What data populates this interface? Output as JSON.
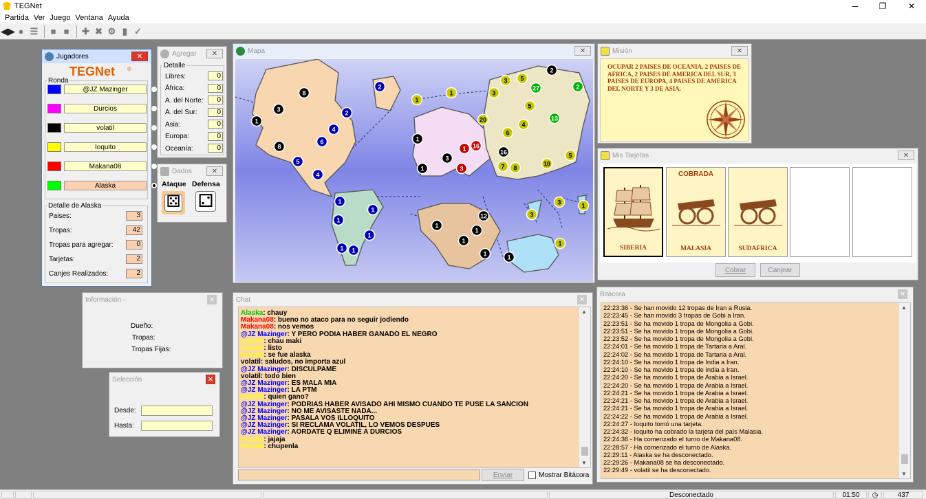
{
  "app": {
    "title": "TEGNet"
  },
  "menu": [
    "Partida",
    "Ver",
    "Juego",
    "Ventana",
    "Ayuda"
  ],
  "jugadores": {
    "title": "Jugadores",
    "logo": "TEGNet",
    "ronda_label": "Ronda",
    "players": [
      {
        "name": "@JZ Mazinger",
        "color": "#0000ff",
        "active": false
      },
      {
        "name": "Durcios",
        "color": "#ff00ff",
        "active": false
      },
      {
        "name": "volatil",
        "color": "#000000",
        "active": false
      },
      {
        "name": "Ioquito",
        "color": "#ffff00",
        "active": false
      },
      {
        "name": "Makana08",
        "color": "#ff0000",
        "active": false
      },
      {
        "name": "Alaska",
        "color": "#00ff00",
        "active": true
      }
    ],
    "detalle_title": "Detalle de Alaska",
    "detalle": [
      {
        "label": "Paises:",
        "value": "3"
      },
      {
        "label": "Tropas:",
        "value": "42"
      },
      {
        "label": "Tropas para agregar:",
        "value": "0"
      },
      {
        "label": "Tarjetas:",
        "value": "2"
      },
      {
        "label": "Canjes Realizados:",
        "value": "2"
      }
    ]
  },
  "agregar": {
    "title": "Agregar",
    "detalle_label": "Detalle",
    "rows": [
      {
        "label": "Libres:",
        "value": "0"
      },
      {
        "label": "África:",
        "value": "0"
      },
      {
        "label": "A. del Norte:",
        "value": "0"
      },
      {
        "label": "A. del Sur:",
        "value": "0"
      },
      {
        "label": "Asia:",
        "value": "0"
      },
      {
        "label": "Europa:",
        "value": "0"
      },
      {
        "label": "Oceanía:",
        "value": "0"
      }
    ]
  },
  "dados": {
    "title": "Dados",
    "ataque": "Ataque",
    "defensa": "Defensa"
  },
  "mapa": {
    "title": "Mapa"
  },
  "mision": {
    "title": "Misión",
    "text": "OCUPAR 2 PAISES DE OCEANIA, 2 PAISES DE AFRICA, 2 PAISES DE AMERICA DEL SUR, 3 PAISES DE EUROPA, 4 PAISES DE AMERICA DEL NORTE Y 3 DE ASIA."
  },
  "tarjetas": {
    "title": "Mis Tarjetas",
    "cards": [
      {
        "name": "SIBERIA",
        "kind": "ship-icon",
        "badge": ""
      },
      {
        "name": "MALASIA",
        "kind": "cannon-icon",
        "badge": "COBRADA"
      },
      {
        "name": "SUDAFRICA",
        "kind": "cannon-icon",
        "badge": ""
      }
    ],
    "cobrar": "Cobrar",
    "canjear": "Canjear"
  },
  "informacion": {
    "title": "Información -",
    "dueno": "Dueño:",
    "tropas": "Tropas:",
    "fijas": "Tropas Fijas:"
  },
  "seleccion": {
    "title": "Selección",
    "desde": "Desde:",
    "hasta": "Hasta:"
  },
  "chat": {
    "title": "Chat",
    "enviar": "Enviar",
    "mostrar": "Mostrar Bitácora",
    "messages": [
      {
        "user": "Alaska",
        "color": "#00c800",
        "text": "chauy"
      },
      {
        "user": "Makana08",
        "color": "#ff0000",
        "text": "bueno no ataco para no seguir jodiendo"
      },
      {
        "user": "Makana08",
        "color": "#ff0000",
        "text": "nos vemos"
      },
      {
        "user": "@JZ Mazinger",
        "color": "#0000ff",
        "text": "Y PERO PODIA HABER GANADO EL NEGRO"
      },
      {
        "user": "Ioquito",
        "color": "#ffff00",
        "text": "chau maki"
      },
      {
        "user": "Ioquito",
        "color": "#ffff00",
        "text": "listo"
      },
      {
        "user": "Ioquito",
        "color": "#ffff00",
        "text": "se fue alaska"
      },
      {
        "user": "volatil",
        "color": "#000000",
        "text": "saludos, no importa azul"
      },
      {
        "user": "@JZ Mazinger",
        "color": "#0000ff",
        "text": "DISCULPAME"
      },
      {
        "user": "volatil",
        "color": "#000000",
        "text": "todo bien"
      },
      {
        "user": "@JZ Mazinger",
        "color": "#0000ff",
        "text": "ES MALA MIA"
      },
      {
        "user": "@JZ Mazinger",
        "color": "#0000ff",
        "text": "LA PTM"
      },
      {
        "user": "Ioquito",
        "color": "#ffff00",
        "text": "quien gano?"
      },
      {
        "user": "@JZ Mazinger",
        "color": "#0000ff",
        "text": "PODRIAS HABER AVISADO AHI MISMO CUANDO TE PUSE LA SANCION"
      },
      {
        "user": "@JZ Mazinger",
        "color": "#0000ff",
        "text": "NO ME AVISASTE NADA..."
      },
      {
        "user": "@JZ Mazinger",
        "color": "#0000ff",
        "text": "PASALA VOS ILLOQUITO"
      },
      {
        "user": "@JZ Mazinger",
        "color": "#0000ff",
        "text": "SI RECLAMA VOLATIL, LO VEMOS DESPUES"
      },
      {
        "user": "@JZ Mazinger",
        "color": "#0000ff",
        "text": "AORDATE Q ELIMINÉ A DURCIOS"
      },
      {
        "user": "Ioquito",
        "color": "#ffff00",
        "text": "jajaja"
      },
      {
        "user": "Ioquito",
        "color": "#ffff00",
        "text": "chupenla"
      }
    ]
  },
  "bitacora": {
    "title": "Bitácora",
    "lines": [
      "22:23:36 - Se han movido 12 tropas de Iran a Rusia.",
      "22:23:45 - Se han movido 3 tropas de Gobi a Iran.",
      "22:23:51 - Se ha movido 1 tropa de Mongolia a Gobi.",
      "22:23:51 - Se ha movido 1 tropa de Mongolia a Gobi.",
      "22:23:52 - Se ha movido 1 tropa de Mongolia a Gobi.",
      "22:24:01 - Se ha movido 1 tropa de Tartaria a Aral.",
      "22:24:02 - Se ha movido 1 tropa de Tartaria a Aral.",
      "22:24:10 - Se ha movido 1 tropa de India a Iran.",
      "22:24:10 - Se ha movido 1 tropa de India a Iran.",
      "22:24:20 - Se ha movido 1 tropa de Arabia a Israel.",
      "22:24:20 - Se ha movido 1 tropa de Arabia a Israel.",
      "22:24:21 - Se ha movido 1 tropa de Arabia a Israel.",
      "22:24:21 - Se ha movido 1 tropa de Arabia a Israel.",
      "22:24:21 - Se ha movido 1 tropa de Arabia a Israel.",
      "22:24:22 - Se ha movido 1 tropa de Arabia a Israel.",
      "22:24:27 - Ioquito tomó una tarjeta.",
      "22:24:32 - Ioquito ha cobrado la tarjeta del país Malasia.",
      "22:24:36 - Ha comenzado el turno de Makana08.",
      "22:28:57 - Ha comenzado el turno de Alaska.",
      "22:29:11 - Alaska se ha desconectado.",
      "22:29:26 - Makana08 se ha desconectado.",
      "22:29:49 - volatil se ha desconectado."
    ]
  },
  "status": {
    "connection": "Desconectado",
    "time": "01:50",
    "count": "437"
  },
  "map_markers": [
    {
      "v": "8",
      "c": "#000000"
    },
    {
      "v": "3",
      "c": "#000000"
    },
    {
      "v": "1",
      "c": "#000000"
    },
    {
      "v": "8",
      "c": "#000000"
    },
    {
      "v": "2",
      "c": "#0000b4"
    },
    {
      "v": "2",
      "c": "#0000b4"
    },
    {
      "v": "4",
      "c": "#0000b4"
    },
    {
      "v": "6",
      "c": "#0000b4"
    },
    {
      "v": "5",
      "c": "#0000b4"
    },
    {
      "v": "4",
      "c": "#0000b4"
    },
    {
      "v": "1",
      "c": "#0000b4"
    },
    {
      "v": "1",
      "c": "#0000b4"
    },
    {
      "v": "1",
      "c": "#0000b4"
    },
    {
      "v": "1",
      "c": "#0000b4"
    },
    {
      "v": "1",
      "c": "#0000b4"
    },
    {
      "v": "1",
      "c": "#0000b4"
    },
    {
      "v": "1",
      "c": "#c8c800"
    },
    {
      "v": "1",
      "c": "#c8c800"
    },
    {
      "v": "1",
      "c": "#000000"
    },
    {
      "v": "3",
      "c": "#000000"
    },
    {
      "v": "1",
      "c": "#000000"
    },
    {
      "v": "1",
      "c": "#c80000"
    },
    {
      "v": "16",
      "c": "#c80000"
    },
    {
      "v": "3",
      "c": "#c80000"
    },
    {
      "v": "3",
      "c": "#c8c800"
    },
    {
      "v": "5",
      "c": "#c8c800"
    },
    {
      "v": "27",
      "c": "#00b400"
    },
    {
      "v": "2",
      "c": "#000000"
    },
    {
      "v": "3",
      "c": "#c8c800"
    },
    {
      "v": "2",
      "c": "#00b400"
    },
    {
      "v": "5",
      "c": "#c8c800"
    },
    {
      "v": "20",
      "c": "#c8c800"
    },
    {
      "v": "4",
      "c": "#c8c800"
    },
    {
      "v": "13",
      "c": "#00b400"
    },
    {
      "v": "6",
      "c": "#c8c800"
    },
    {
      "v": "16",
      "c": "#000000"
    },
    {
      "v": "7",
      "c": "#c8c800"
    },
    {
      "v": "8",
      "c": "#c8c800"
    },
    {
      "v": "10",
      "c": "#c8c800"
    },
    {
      "v": "5",
      "c": "#c8c800"
    },
    {
      "v": "1",
      "c": "#000000"
    },
    {
      "v": "12",
      "c": "#000000"
    },
    {
      "v": "1",
      "c": "#000000"
    },
    {
      "v": "1",
      "c": "#000000"
    },
    {
      "v": "1",
      "c": "#000000"
    },
    {
      "v": "1",
      "c": "#000000"
    },
    {
      "v": "3",
      "c": "#c8c800"
    },
    {
      "v": "3",
      "c": "#c8c800"
    },
    {
      "v": "1",
      "c": "#c8c800"
    },
    {
      "v": "1",
      "c": "#c8c800"
    }
  ]
}
